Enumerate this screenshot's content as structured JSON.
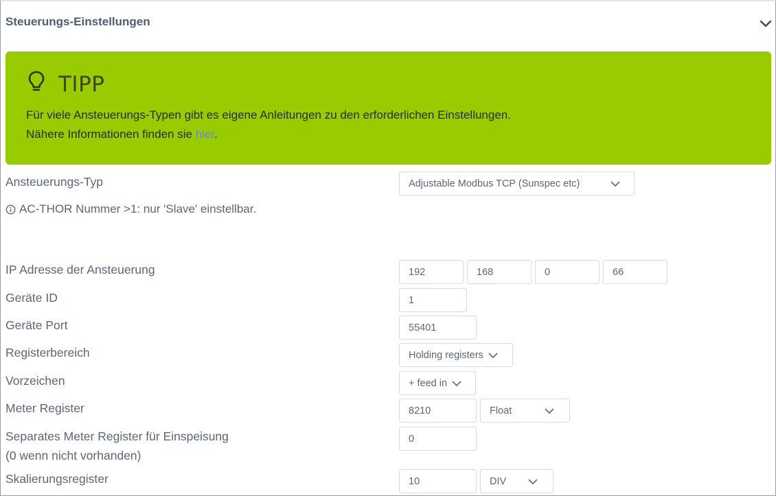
{
  "header": {
    "title": "Steuerungs-Einstellungen"
  },
  "tip": {
    "title": "TIPP",
    "line1": "Für viele Ansteuerungs-Typen gibt es eigene Anleitungen zu den erforderlichen Einstellungen.",
    "line2_prefix": "Nähere Informationen finden sie ",
    "link": "hier",
    "line2_suffix": "."
  },
  "form": {
    "control_type": {
      "label": "Ansteuerungs-Typ",
      "value": "Adjustable Modbus TCP (Sunspec etc)"
    },
    "note": "AC-THOR Nummer >1: nur 'Slave' einstellbar.",
    "ip": {
      "label": "IP Adresse der Ansteuerung",
      "octets": [
        "192",
        "168",
        "0",
        "66"
      ]
    },
    "device_id": {
      "label": "Geräte ID",
      "value": "1"
    },
    "device_port": {
      "label": "Geräte Port",
      "value": "55401"
    },
    "register_range": {
      "label": "Registerbereich",
      "value": "Holding registers"
    },
    "sign": {
      "label": "Vorzeichen",
      "value": "+ feed in"
    },
    "meter_register": {
      "label": "Meter Register",
      "value": "8210",
      "type": "Float"
    },
    "separate_meter": {
      "label_line1": "Separates Meter Register für Einspeisung",
      "label_line2": "(0 wenn nicht vorhanden)",
      "value": "0"
    },
    "scaling": {
      "label": "Skalierungsregister",
      "value": "10",
      "op": "DIV"
    }
  },
  "colors": {
    "tip_bg": "#99cc00",
    "link": "#6d86c9",
    "text": "#5b6677"
  }
}
